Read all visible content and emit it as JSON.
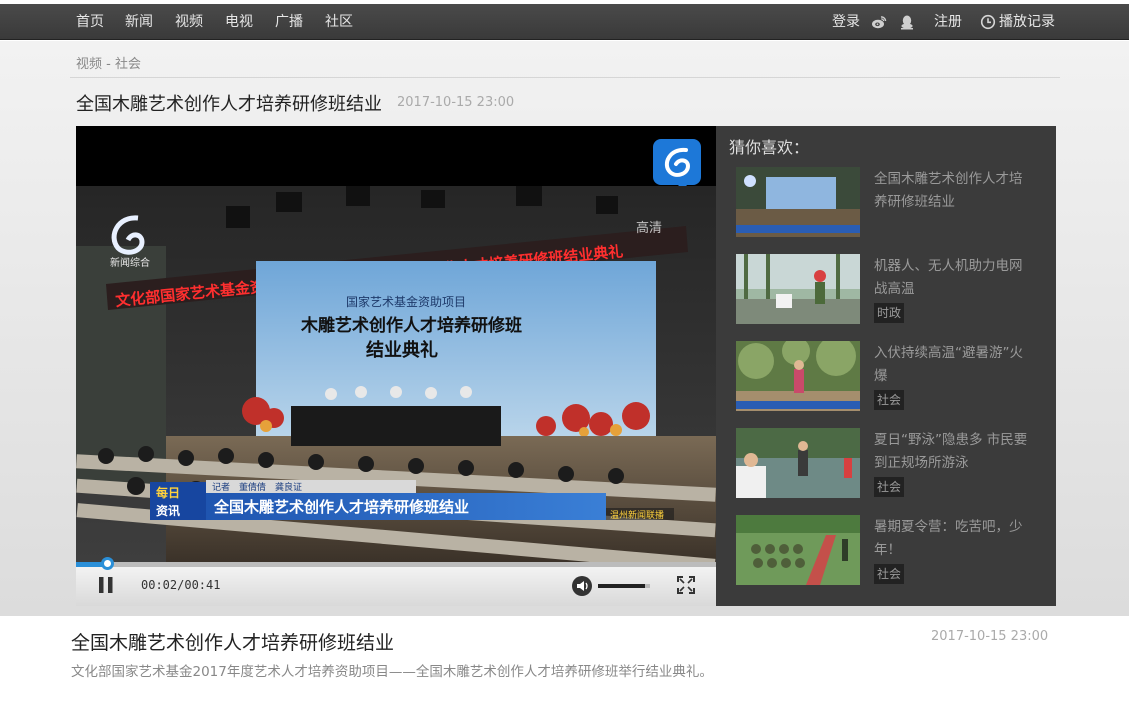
{
  "nav": {
    "items": [
      "首页",
      "新闻",
      "视频",
      "电视",
      "广播",
      "社区"
    ],
    "login": "登录",
    "register": "注册",
    "history": "播放记录"
  },
  "breadcrumb": "视频 - 社会",
  "video": {
    "title": "全国木雕艺术创作人才培养研修班结业",
    "date": "2017-10-15 23:00",
    "description": "文化部国家艺术基金2017年度艺术人才培养资助项目——全国木雕艺术创作人才培养研修班举行结业典礼。"
  },
  "player": {
    "time": "00:02/00:41",
    "progress": 0.049,
    "volume": 0.9,
    "overlay": {
      "channel_label": "新闻综合",
      "hd_label": "高清",
      "banner_red": "文化部国家艺术基金资助项目——全国木雕艺术创作人才培养研修班结业典礼",
      "screen_line1": "国家艺术基金资助项目",
      "screen_line2": "木雕艺术创作人才培养研修班",
      "screen_line3": "结业典礼",
      "program_badge_1": "每日",
      "program_badge_2": "资讯",
      "reporter": "记者　董倩倩　龚良证",
      "caption": "全国木雕艺术创作人才培养研修班结业",
      "corner": "温州新闻联播"
    }
  },
  "recommendations": {
    "title": "猜你喜欢：",
    "items": [
      {
        "title": "全国木雕艺术创作人才培养研修班结业",
        "tag": ""
      },
      {
        "title": "机器人、无人机助力电网战高温",
        "tag": "时政"
      },
      {
        "title": "入伏持续高温“避暑游”火爆",
        "tag": "社会"
      },
      {
        "title": "夏日“野泳”隐患多 市民要到正规场所游泳",
        "tag": "社会"
      },
      {
        "title": "暑期夏令营：吃苦吧，少年！",
        "tag": "社会"
      }
    ]
  },
  "colors": {
    "accent": "#2a8fd8",
    "topbar": "#3f3f3f",
    "panel": "#3b3b3b",
    "banner_red": "#d8262b"
  }
}
